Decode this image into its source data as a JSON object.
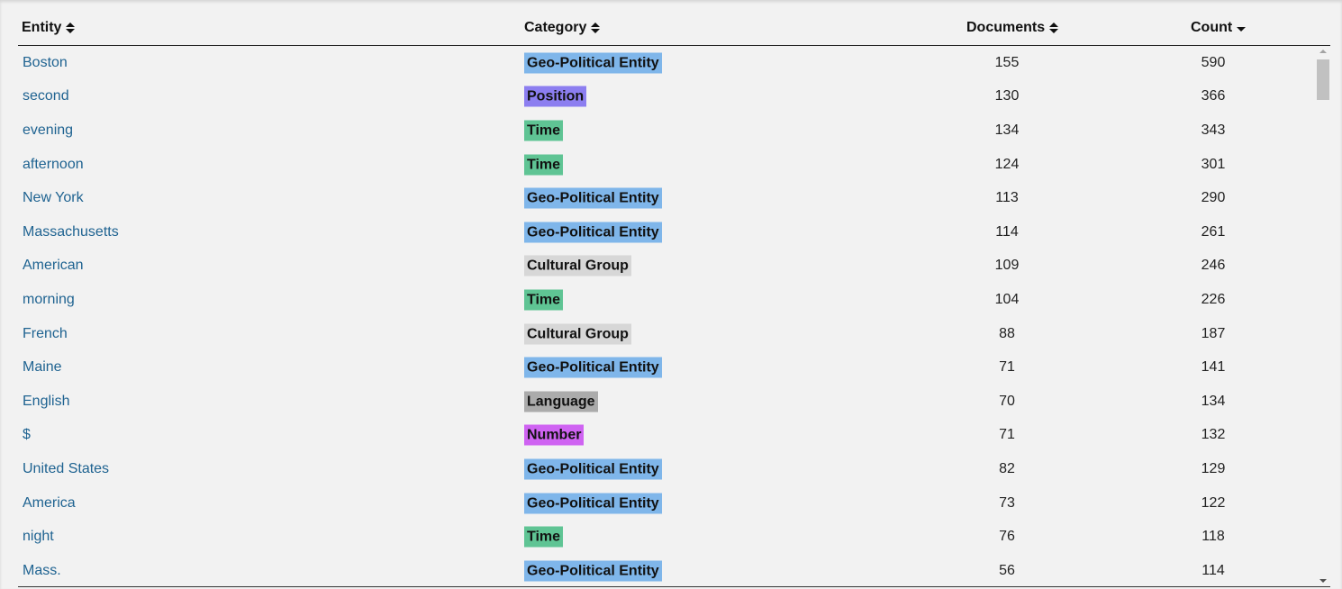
{
  "table": {
    "columns": {
      "entity": "Entity",
      "category": "Category",
      "documents": "Documents",
      "count": "Count"
    },
    "sort": {
      "column": "count",
      "direction": "descending"
    },
    "category_colors": {
      "Geo-Political Entity": "#7fb6ea",
      "Position": "#8c7ef0",
      "Time": "#5fc494",
      "Cultural Group": "#d7d7d7",
      "Language": "#ababab",
      "Number": "#cf63f2"
    },
    "rows": [
      {
        "entity": "Boston",
        "category": "Geo-Political Entity",
        "documents": "155",
        "count": "590"
      },
      {
        "entity": "second",
        "category": "Position",
        "documents": "130",
        "count": "366"
      },
      {
        "entity": "evening",
        "category": "Time",
        "documents": "134",
        "count": "343"
      },
      {
        "entity": "afternoon",
        "category": "Time",
        "documents": "124",
        "count": "301"
      },
      {
        "entity": "New York",
        "category": "Geo-Political Entity",
        "documents": "113",
        "count": "290"
      },
      {
        "entity": "Massachusetts",
        "category": "Geo-Political Entity",
        "documents": "114",
        "count": "261"
      },
      {
        "entity": "American",
        "category": "Cultural Group",
        "documents": "109",
        "count": "246"
      },
      {
        "entity": "morning",
        "category": "Time",
        "documents": "104",
        "count": "226"
      },
      {
        "entity": "French",
        "category": "Cultural Group",
        "documents": "88",
        "count": "187"
      },
      {
        "entity": "Maine",
        "category": "Geo-Political Entity",
        "documents": "71",
        "count": "141"
      },
      {
        "entity": "English",
        "category": "Language",
        "documents": "70",
        "count": "134"
      },
      {
        "entity": "$",
        "category": "Number",
        "documents": "71",
        "count": "132"
      },
      {
        "entity": "United States",
        "category": "Geo-Political Entity",
        "documents": "82",
        "count": "129"
      },
      {
        "entity": "America",
        "category": "Geo-Political Entity",
        "documents": "73",
        "count": "122"
      },
      {
        "entity": "night",
        "category": "Time",
        "documents": "76",
        "count": "118"
      },
      {
        "entity": "Mass.",
        "category": "Geo-Political Entity",
        "documents": "56",
        "count": "114"
      }
    ]
  }
}
